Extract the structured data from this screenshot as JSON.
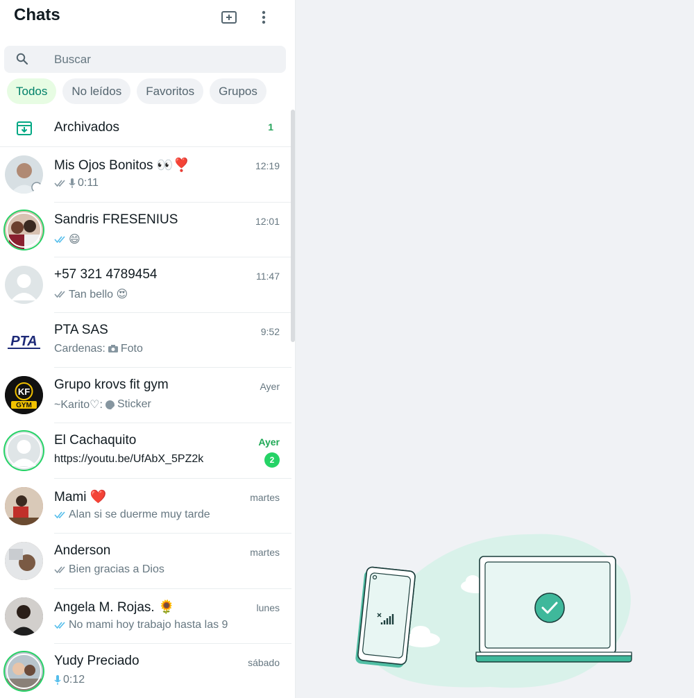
{
  "header": {
    "title": "Chats"
  },
  "search": {
    "placeholder": "Buscar"
  },
  "chips": [
    "Todos",
    "No leídos",
    "Favoritos",
    "Grupos"
  ],
  "archived": {
    "label": "Archivados",
    "count": "1"
  },
  "chats": [
    {
      "name": "Mis Ojos Bonitos 👀❣️",
      "time": "12:19",
      "preview": "0:11",
      "tick": "grey",
      "voice": true,
      "avatar_color": "#c9d3d8"
    },
    {
      "name": "Sandris FRESENIUS",
      "time": "12:01",
      "preview": "😄",
      "tick": "blue",
      "avatar_color": "#8a5a4a"
    },
    {
      "name": "+57 321 4789454",
      "time": "11:47",
      "preview": "Tan bello 😍",
      "tick": "grey",
      "avatar_color": "#dfe5e7"
    },
    {
      "name": "PTA SAS",
      "time": "9:52",
      "preview_sender": "Cardenas:",
      "preview": "Foto",
      "camera": true,
      "avatar_color": "#ffffff"
    },
    {
      "name": "Grupo krovs fit gym",
      "time": "Ayer",
      "preview_sender": "~Karito♡:",
      "preview": "Sticker",
      "sticker": true,
      "avatar_color": "#111111"
    },
    {
      "name": "El Cachaquito",
      "time": "Ayer",
      "preview": "https://youtu.be/UfAbX_5PZ2k",
      "unread": "2",
      "avatar_color": "#dfe5e7"
    },
    {
      "name": "Mami ❤️",
      "time": "martes",
      "preview": "Alan si se duerme muy tarde",
      "tick": "blue",
      "avatar_color": "#b5694a"
    },
    {
      "name": "Anderson",
      "time": "martes",
      "preview": "Bien gracias a Dios",
      "tick": "grey",
      "avatar_color": "#8b7a6a"
    },
    {
      "name": "Angela M. Rojas. 🌻",
      "time": "lunes",
      "preview": "No mami hoy trabajo hasta las 9",
      "tick": "blue",
      "avatar_color": "#6a6a6a"
    },
    {
      "name": "Yudy Preciado",
      "time": "sábado",
      "preview": "0:12",
      "voice_blue": true,
      "avatar_color": "#9a8a80"
    }
  ],
  "pta_logo_text": "PTA",
  "gym_logo_text": "KF",
  "gym_logo_sub": "GYM",
  "colors": {
    "accent": "#25d366",
    "accent_dark": "#008069",
    "panel_bg": "#f0f2f5"
  }
}
